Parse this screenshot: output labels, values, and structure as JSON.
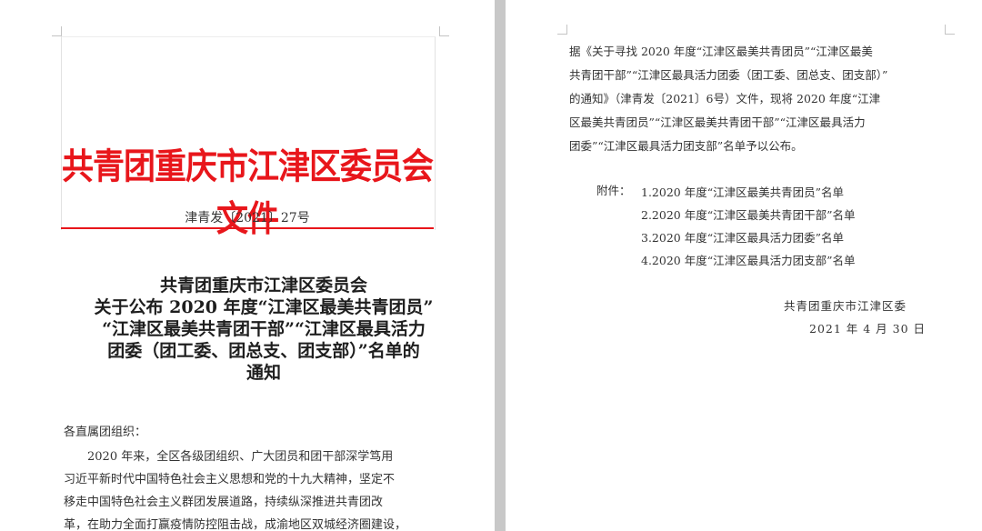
{
  "left_page": {
    "header": {
      "red_title": "共青团重庆市江津区委员会文件",
      "doc_number": "津青发〔2021〕27号"
    },
    "notice_title": {
      "line1": "共青团重庆市江津区委员会",
      "line2": "关于公布 2020 年度“江津区最美共青团员”",
      "line3": "“江津区最美共青团干部”“江津区最具活力",
      "line4": "团委（团工委、团总支、团支部）”名单的",
      "line5": "通知"
    },
    "salutation": "各直属团组织：",
    "body_lines": [
      "2020 年来，全区各级团组织、广大团员和团干部深学笃用",
      "习近平新时代中国特色社会主义思想和党的十九大精神，坚定不",
      "移走中国特色社会主义群团发展道路，持续纵深推进共青团改",
      "革，在助力全面打赢疫情防控阻击战，成渝地区双城经济圈建设，"
    ]
  },
  "right_page": {
    "paragraph_lines": [
      "据《关于寻找 2020 年度“江津区最美共青团员”“江津区最美",
      "共青团干部”“江津区最具活力团委（团工委、团总支、团支部）”",
      "的通知》（津青发〔2021〕6号）文件，现将 2020 年度“江津",
      "区最美共青团员”“江津区最美共青团干部”“江津区最具活力",
      "团委”“江津区最具活力团支部”名单予以公布。"
    ],
    "attachment_label": "附件：",
    "attachments": [
      "1.2020 年度“江津区最美共青团员”名单",
      "2.2020 年度“江津区最美共青团干部”名单",
      "3.2020 年度“江津区最具活力团委”名单",
      "4.2020 年度“江津区最具活力团支部”名单"
    ],
    "signature_org": "共青团重庆市江津区委",
    "signature_date": "2021 年 4 月 30 日"
  },
  "colors": {
    "red_header": "#e8161b",
    "gutter": "#c8c8c8",
    "text": "#333333"
  }
}
